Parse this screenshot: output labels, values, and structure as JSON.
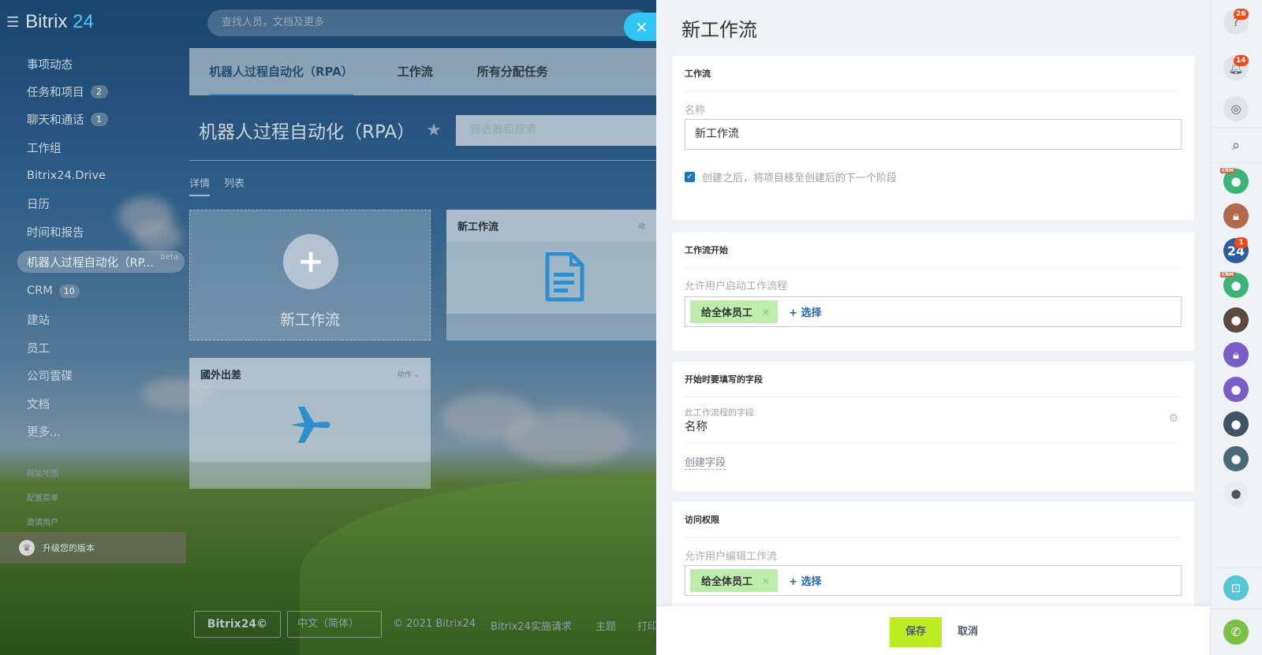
{
  "left_menu": {
    "brand_name": "Bitrix",
    "brand_number": "24",
    "items": [
      {
        "label": "事项动态",
        "counter": ""
      },
      {
        "label": "任务和项目",
        "counter": "2"
      },
      {
        "label": "聊天和通话",
        "counter": "1"
      },
      {
        "label": "工作组",
        "counter": ""
      },
      {
        "label": "Bitrix24.Drive",
        "counter": ""
      },
      {
        "label": "日历",
        "counter": ""
      },
      {
        "label": "时间和报告",
        "counter": ""
      },
      {
        "label": "机器人过程自动化（RP...",
        "counter": ""
      },
      {
        "label": "CRM",
        "counter": "10"
      },
      {
        "label": "建站",
        "counter": ""
      },
      {
        "label": "员工",
        "counter": ""
      },
      {
        "label": "公司雲碟",
        "counter": ""
      },
      {
        "label": "文档",
        "counter": ""
      },
      {
        "label": "更多...",
        "counter": ""
      }
    ],
    "active_beta": "beta",
    "small_links": [
      "网站地图",
      "配置菜单",
      "邀请用户"
    ],
    "upgrade_label": "升级您的版本"
  },
  "top_search": {
    "placeholder": "查找人员，文档及更多"
  },
  "main": {
    "tabs": [
      "机器人过程自动化（RPA）",
      "工作流",
      "所有分配任务"
    ],
    "page_title": "机器人过程自动化（RPA）",
    "filter_placeholder": "筛选器和搜索",
    "view_tabs": [
      "详情",
      "列表"
    ],
    "cards": {
      "new_label": "新工作流",
      "workflow_title": "新工作流",
      "workflow_action": "动",
      "travel_title": "國外出差",
      "travel_action": "动作"
    },
    "footer": {
      "brand": "Bitrix24©",
      "language": "中文（简体）",
      "copyright": "© 2021 Bitrix24",
      "links": [
        "Bitrix24实施请求",
        "主题",
        "打印"
      ]
    }
  },
  "slider": {
    "title": "新工作流",
    "section_workflow": {
      "title": "工作流",
      "name_label": "名称",
      "name_value": "新工作流",
      "checkbox_label": "创建之后，将项目移至创建后的下一个阶段",
      "checkbox_checked": true
    },
    "section_start": {
      "title": "工作流开始",
      "allow_label": "允许用户启动工作流程",
      "chip": "给全体员工",
      "add_label": "+ 选择"
    },
    "section_fields": {
      "title": "开始时要填写的字段",
      "field_caption": "此工作流程的字段",
      "field_name": "名称",
      "create_link": "创建字段"
    },
    "section_access": {
      "title": "访问权限",
      "edit_label": "允许用户编辑工作流",
      "chip": "给全体员工",
      "add_label": "+ 选择"
    },
    "buttons": {
      "save": "保存",
      "cancel": "取消"
    }
  },
  "right_bar": {
    "help_badge": "26",
    "notify_badge": "14",
    "b24_label": "24",
    "b24_badge": "1",
    "crm_tag": "CRM"
  },
  "colors": {
    "accent_blue": "#2fc6f6",
    "save_green": "#bbed21",
    "chip_green": "#bcedaa",
    "badge_red": "#f54819"
  }
}
